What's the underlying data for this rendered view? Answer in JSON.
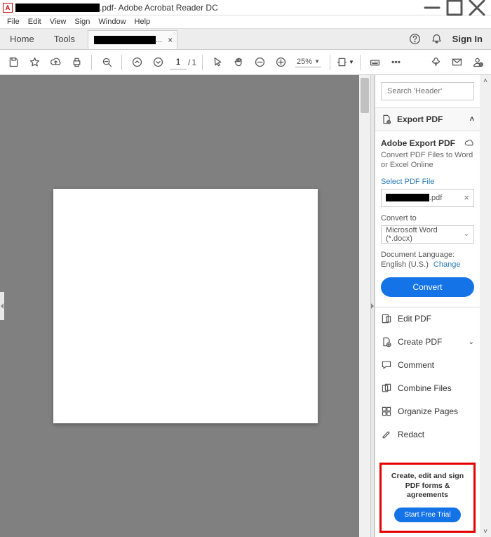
{
  "title": {
    "filename_suffix": ".pdf",
    "app": " - Adobe Acrobat Reader DC"
  },
  "menu": [
    "File",
    "Edit",
    "View",
    "Sign",
    "Window",
    "Help"
  ],
  "tabs": {
    "home": "Home",
    "tools": "Tools",
    "doc_suffix": "..."
  },
  "topright": {
    "sign_in": "Sign In"
  },
  "toolbar": {
    "page_current": "1",
    "page_total": "1",
    "page_sep": "/",
    "zoom": "25%"
  },
  "right": {
    "search_placeholder": "Search 'Header'",
    "export": {
      "header": "Export PDF",
      "title": "Adobe Export PDF",
      "sub": "Convert PDF Files to Word or Excel Online",
      "select_label": "Select PDF File",
      "file_suffix": ".pdf",
      "convert_label": "Convert to",
      "convert_value": "Microsoft Word (*.docx)",
      "lang_label": "Document Language:",
      "lang_value": "English (U.S.)",
      "change": "Change",
      "button": "Convert"
    },
    "tools": [
      {
        "label": "Edit PDF",
        "color": "#d6336c"
      },
      {
        "label": "Create PDF",
        "color": "#d6336c",
        "chev": true
      },
      {
        "label": "Comment",
        "color": "#e8b33a"
      },
      {
        "label": "Combine Files",
        "color": "#3b5fc1"
      },
      {
        "label": "Organize Pages",
        "color": "#5aa02c"
      },
      {
        "label": "Redact",
        "color": "#d6336c"
      }
    ],
    "promo": {
      "text": "Create, edit and sign PDF forms & agreements",
      "button": "Start Free Trial"
    }
  }
}
